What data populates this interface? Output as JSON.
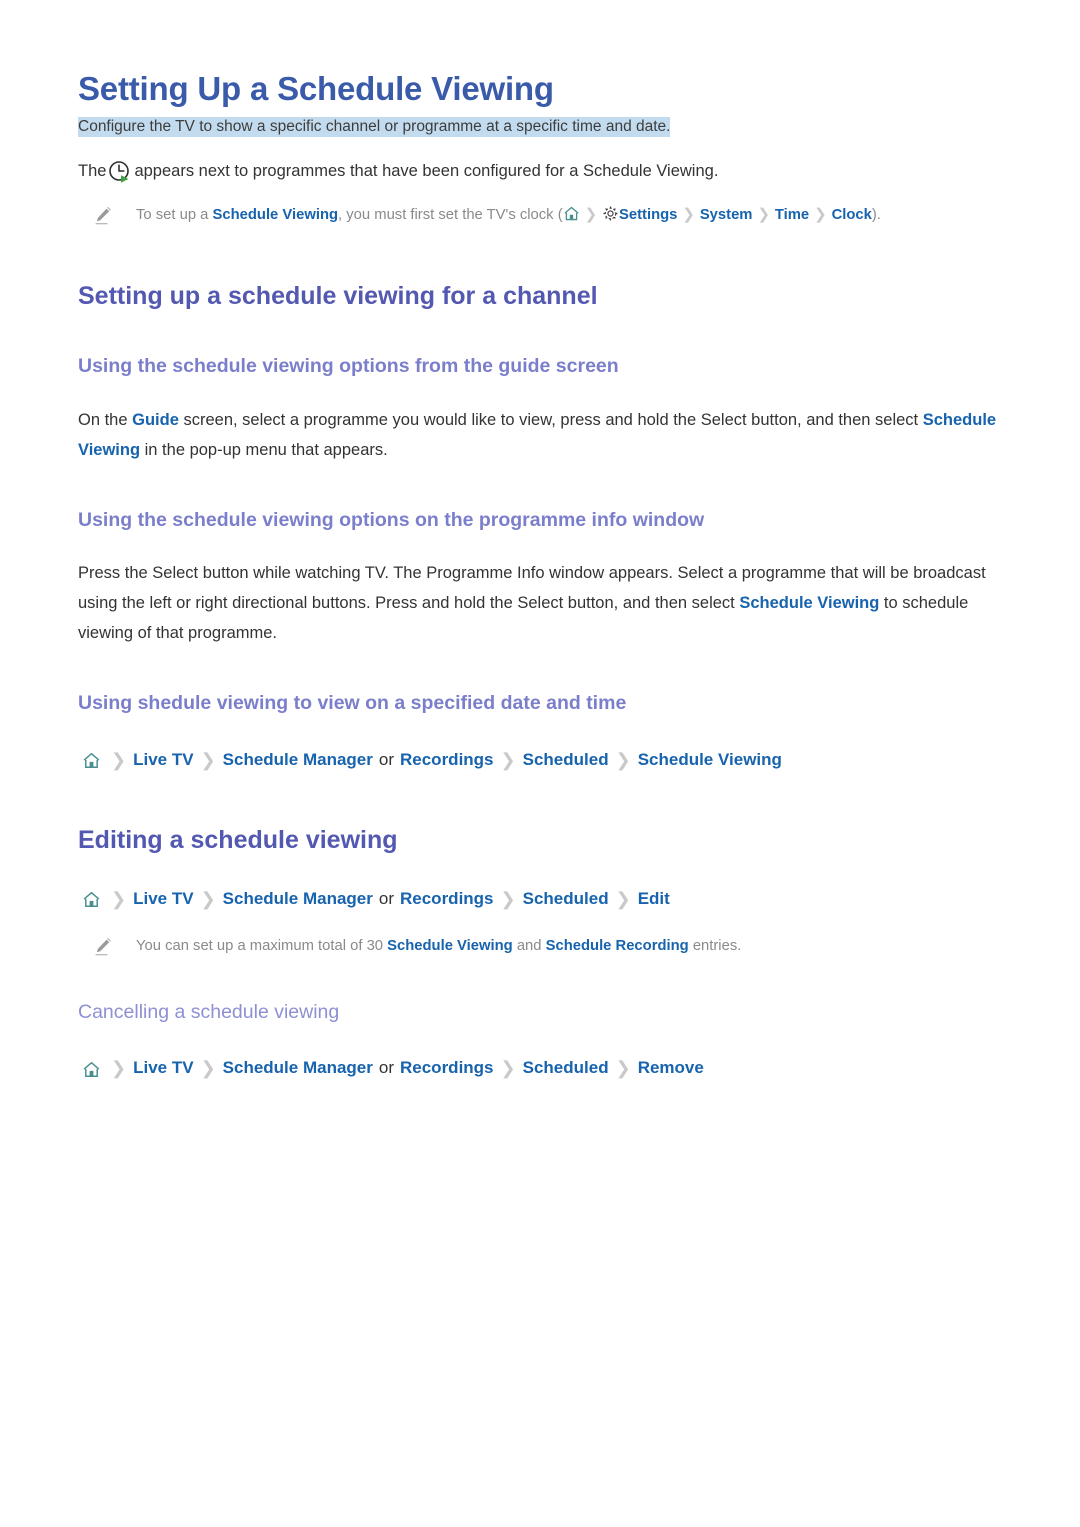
{
  "document": {
    "title": "Setting Up a Schedule Viewing",
    "subtitle": "Configure the TV to show a specific channel or programme at a specific time and date.",
    "intro": {
      "before_icon": "The",
      "icon": "schedule-clock-icon",
      "after_icon": "appears next to programmes that have been configured for a Schedule Viewing."
    },
    "clock_note": {
      "text_1": "To set up a ",
      "link_1": "Schedule Viewing",
      "text_2": ", you must first set the TV's clock (",
      "path": [
        "Settings",
        "System",
        "Time",
        "Clock"
      ],
      "text_3": ")."
    }
  },
  "section_channel": {
    "heading": "Setting up a schedule viewing for a channel",
    "sub_guide": {
      "heading": "Using the schedule viewing options from the guide screen",
      "para": {
        "t1": "On the ",
        "l1": "Guide",
        "t2": " screen, select a programme you would like to view, press and hold the Select button, and then select ",
        "l2": "Schedule Viewing",
        "t3": " in the pop-up menu that appears."
      }
    },
    "sub_info": {
      "heading": "Using the schedule viewing options on the programme info window",
      "para": {
        "t1": "Press the Select button while watching TV. The Programme Info window appears. Select a programme that will be broadcast using the left or right directional buttons. Press and hold the Select button, and then select ",
        "l1": "Schedule Viewing",
        "t2": " to schedule viewing of that programme."
      }
    },
    "sub_datetime": {
      "heading": "Using shedule viewing to view on a specified date and time",
      "path": {
        "home_icon": "home-icon",
        "items": [
          "Live TV",
          "Schedule Manager",
          "Recordings",
          "Scheduled",
          "Schedule Viewing"
        ],
        "or_word": "or"
      }
    }
  },
  "section_editing": {
    "heading": "Editing a schedule viewing",
    "path": {
      "home_icon": "home-icon",
      "items": [
        "Live TV",
        "Schedule Manager",
        "Recordings",
        "Scheduled",
        "Edit"
      ],
      "or_word": "or"
    },
    "note": {
      "t1": "You can set up a maximum total of 30 ",
      "l1": "Schedule Viewing",
      "t2": " and ",
      "l2": "Schedule Recording",
      "t3": " entries."
    }
  },
  "section_cancelling": {
    "heading": "Cancelling a schedule viewing",
    "path": {
      "home_icon": "home-icon",
      "items": [
        "Live TV",
        "Schedule Manager",
        "Recordings",
        "Scheduled",
        "Remove"
      ],
      "or_word": "or"
    }
  },
  "colors": {
    "title_blue": "#3a5ba9",
    "h2_purple": "#5358b0",
    "h3_purple": "#7b7fcb",
    "link_blue": "#1763ae",
    "highlight": "#c3dbee",
    "chevron_gray": "#c9c9c9",
    "note_gray": "#8a8a8a",
    "home_icon_teal": "#4a8f90",
    "play_green": "#43a047"
  },
  "icons": {
    "clock": "schedule-clock-icon",
    "home": "home-icon",
    "gear": "gear-icon",
    "pencil": "pencil-icon",
    "chevron": "›"
  }
}
